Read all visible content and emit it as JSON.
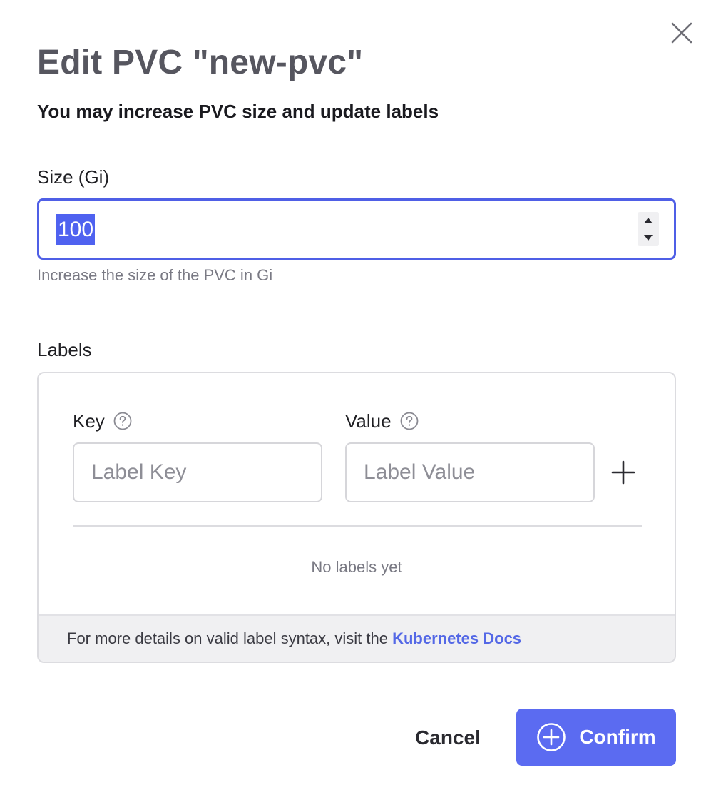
{
  "dialog": {
    "title": "Edit PVC \"new-pvc\"",
    "subtitle": "You may increase PVC size and update labels",
    "close_icon": "close-icon"
  },
  "size": {
    "label": "Size (Gi)",
    "value": "100",
    "helper": "Increase the size of the PVC in Gi"
  },
  "labels": {
    "section_label": "Labels",
    "key_label": "Key",
    "key_placeholder": "Label Key",
    "value_label": "Value",
    "value_placeholder": "Label Value",
    "empty_text": "No labels yet",
    "footer_text": "For more details on valid label syntax, visit the ",
    "docs_link": "Kubernetes Docs",
    "help_icon": "question-circle-icon",
    "add_icon": "plus-icon"
  },
  "actions": {
    "cancel_label": "Cancel",
    "confirm_label": "Confirm",
    "confirm_icon": "plus-circle-icon"
  },
  "colors": {
    "accent": "#5b6bf1",
    "focus_border": "#4f5fe6",
    "selection": "#4f62f0",
    "link": "#5468e6",
    "title": "#56565f",
    "muted_text": "#7a7a84",
    "footer_bg": "#f0f0f2"
  }
}
